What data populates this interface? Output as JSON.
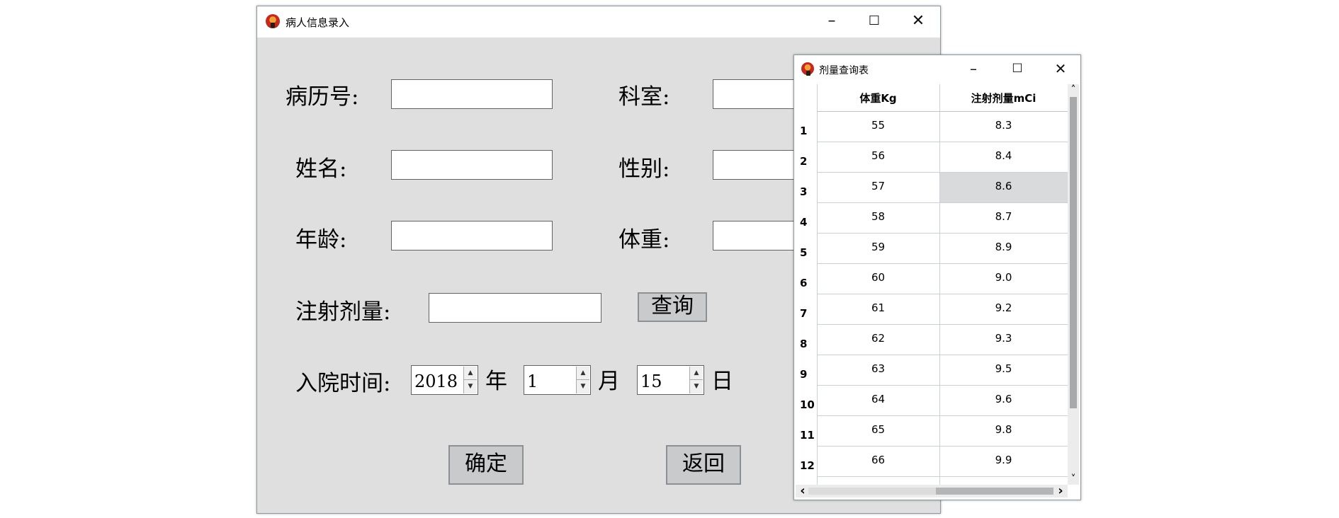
{
  "main_window": {
    "title": "病人信息录入",
    "minimize": "–",
    "maximize": "☐",
    "close": "✕",
    "labels": {
      "record_no": "病历号:",
      "department": "科室:",
      "name": "姓名:",
      "gender": "性别:",
      "age": "年龄:",
      "weight": "体重:",
      "dose": "注射剂量:",
      "admit_time": "入院时间:",
      "year": "年",
      "month": "月",
      "day": "日"
    },
    "values": {
      "year": "2018",
      "month": "1",
      "day": "15"
    },
    "buttons": {
      "query": "查询",
      "confirm": "确定",
      "back": "返回"
    }
  },
  "table_window": {
    "title": "剂量查询表",
    "minimize": "–",
    "maximize": "☐",
    "close": "✕",
    "columns": [
      "体重Kg",
      "注射剂量mCi"
    ],
    "rows": [
      {
        "index": "1",
        "weight": "55",
        "dose": "8.3"
      },
      {
        "index": "2",
        "weight": "56",
        "dose": "8.4"
      },
      {
        "index": "3",
        "weight": "57",
        "dose": "8.6"
      },
      {
        "index": "4",
        "weight": "58",
        "dose": "8.7"
      },
      {
        "index": "5",
        "weight": "59",
        "dose": "8.9"
      },
      {
        "index": "6",
        "weight": "60",
        "dose": "9.0"
      },
      {
        "index": "7",
        "weight": "61",
        "dose": "9.2"
      },
      {
        "index": "8",
        "weight": "62",
        "dose": "9.3"
      },
      {
        "index": "9",
        "weight": "63",
        "dose": "9.5"
      },
      {
        "index": "10",
        "weight": "64",
        "dose": "9.6"
      },
      {
        "index": "11",
        "weight": "65",
        "dose": "9.8"
      },
      {
        "index": "12",
        "weight": "66",
        "dose": "9.9"
      }
    ],
    "selected_row_index": 1,
    "scroll_left": "‹",
    "scroll_right": "›",
    "scroll_up": "˄",
    "scroll_down": "˅"
  }
}
